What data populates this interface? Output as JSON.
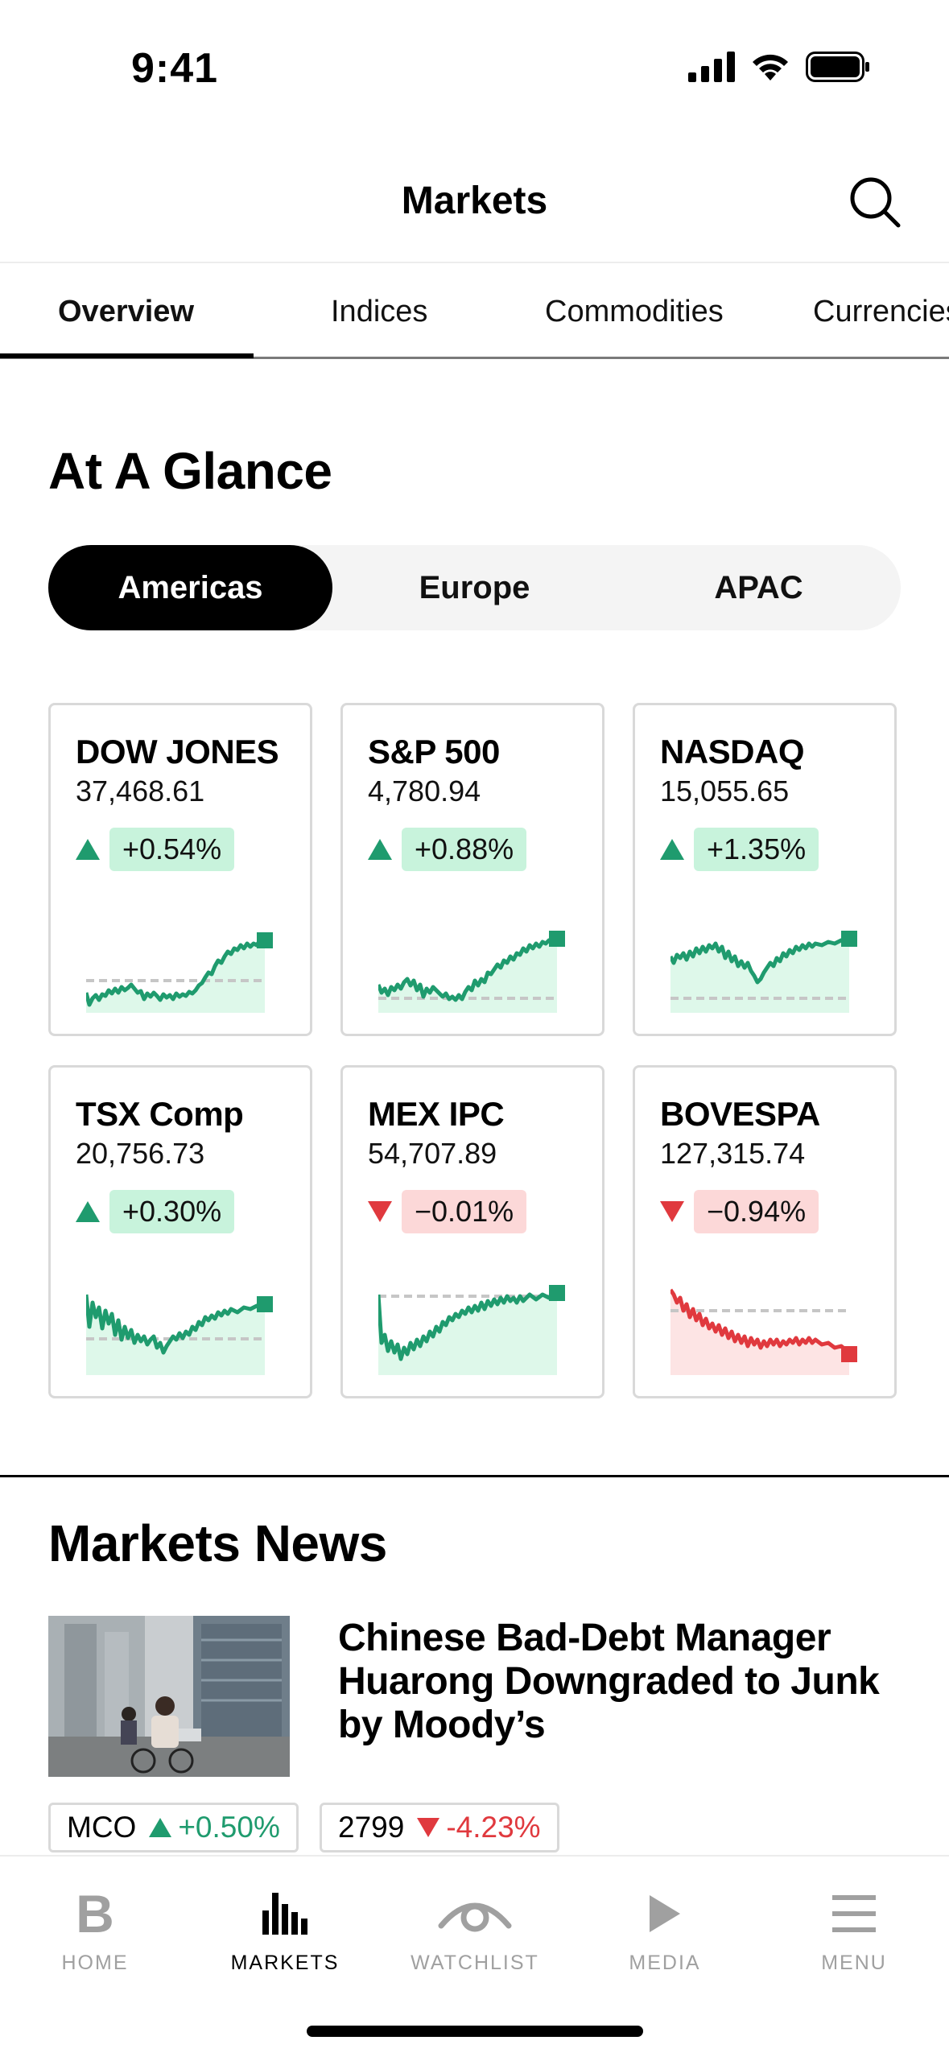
{
  "status": {
    "time": "9:41"
  },
  "header": {
    "title": "Markets"
  },
  "tabs": [
    {
      "label": "Overview",
      "active": true
    },
    {
      "label": "Indices"
    },
    {
      "label": "Commodities"
    },
    {
      "label": "Currencies"
    }
  ],
  "glance": {
    "title": "At A Glance",
    "regions": [
      "Americas",
      "Europe",
      "APAC"
    ],
    "selected_region": "Americas",
    "indices": [
      {
        "name": "DOW JONES",
        "price": "37,468.61",
        "change": "+0.54%",
        "direction": "up"
      },
      {
        "name": "S&P 500",
        "price": "4,780.94",
        "change": "+0.88%",
        "direction": "up"
      },
      {
        "name": "NASDAQ",
        "price": "15,055.65",
        "change": "+1.35%",
        "direction": "up"
      },
      {
        "name": "TSX Comp",
        "price": "20,756.73",
        "change": "+0.30%",
        "direction": "up"
      },
      {
        "name": "MEX IPC",
        "price": "54,707.89",
        "change": "−0.01%",
        "direction": "down"
      },
      {
        "name": "BOVESPA",
        "price": "127,315.74",
        "change": "−0.94%",
        "direction": "down"
      }
    ]
  },
  "news": {
    "title": "Markets News",
    "items": [
      {
        "headline": "Chinese Bad-Debt Manager Huarong Downgraded to Junk by Moody’s",
        "tickers": [
          {
            "symbol": "MCO",
            "change": "+0.50%",
            "direction": "up"
          },
          {
            "symbol": "2799",
            "change": "-4.23%",
            "direction": "down"
          }
        ]
      }
    ]
  },
  "tabbar": [
    {
      "label": "HOME",
      "icon": "b-logo-icon"
    },
    {
      "label": "MARKETS",
      "icon": "bar-chart-icon",
      "active": true
    },
    {
      "label": "WATCHLIST",
      "icon": "eye-icon"
    },
    {
      "label": "MEDIA",
      "icon": "play-icon"
    },
    {
      "label": "MENU",
      "icon": "hamburger-icon"
    }
  ],
  "colors": {
    "up": "#1f9b6e",
    "up_fill": "#c8f3dc",
    "down": "#e0393e",
    "down_fill": "#fcd8d8",
    "active_tab": "#000000",
    "inactive": "#a0a0a0"
  }
}
